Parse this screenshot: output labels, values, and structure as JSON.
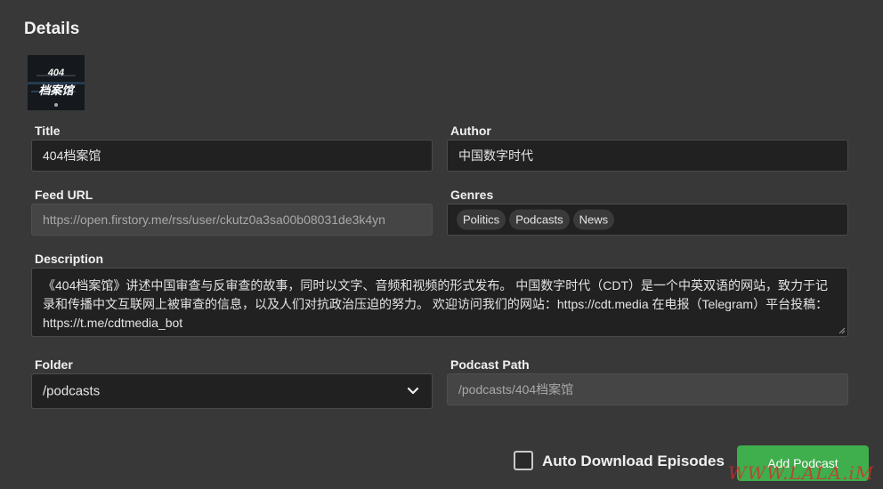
{
  "heading": "Details",
  "cover": {
    "text_line1": "404",
    "text_line2": "档案馆"
  },
  "title": {
    "label": "Title",
    "value": "404档案馆"
  },
  "author": {
    "label": "Author",
    "value": "中国数字时代"
  },
  "feed_url": {
    "label": "Feed URL",
    "value": "https://open.firstory.me/rss/user/ckutz0a3sa00b08031de3k4yn"
  },
  "genres": {
    "label": "Genres",
    "items": [
      "Politics",
      "Podcasts",
      "News"
    ]
  },
  "description": {
    "label": "Description",
    "value": "《404档案馆》讲述中国审查与反审查的故事，同时以文字、音频和视频的形式发布。 中国数字时代（CDT）是一个中英双语的网站，致力于记录和传播中文互联网上被审查的信息，以及人们对抗政治压迫的努力。 欢迎访问我们的网站：https://cdt.media 在电报（Telegram）平台投稿：https://t.me/cdtmedia_bot"
  },
  "folder": {
    "label": "Folder",
    "value": "/podcasts"
  },
  "podcast_path": {
    "label": "Podcast Path",
    "value": "/podcasts/404档案馆"
  },
  "auto_download": {
    "label": "Auto Download Episodes",
    "checked": false
  },
  "add_button": {
    "label": "Add Podcast",
    "color": "#3fae4c"
  },
  "watermark": "WWW.LALA.iM"
}
